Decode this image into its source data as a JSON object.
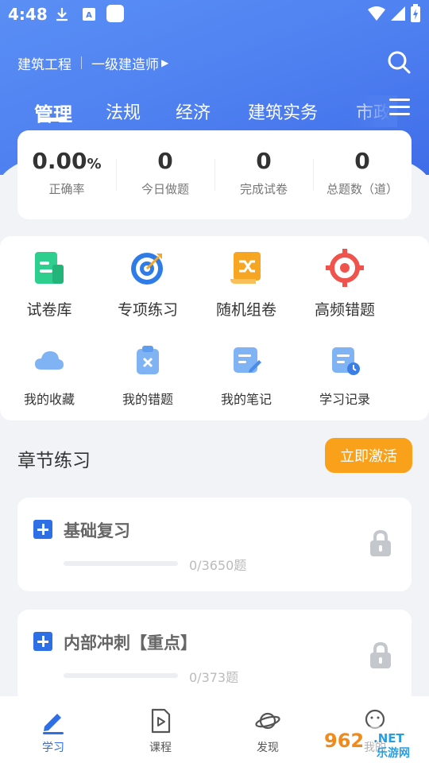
{
  "status_bar": {
    "time": "4:48"
  },
  "header": {
    "category": "建筑工程",
    "level": "一级建造师"
  },
  "tabs": [
    {
      "label": "管理",
      "active": true
    },
    {
      "label": "法规",
      "active": false
    },
    {
      "label": "经济",
      "active": false
    },
    {
      "label": "建筑实务",
      "active": false
    },
    {
      "label": "市政",
      "active": false
    }
  ],
  "stats": [
    {
      "value": "0.00",
      "unit": "%",
      "label": "正确率"
    },
    {
      "value": "0",
      "unit": "",
      "label": "今日做题"
    },
    {
      "value": "0",
      "unit": "",
      "label": "完成试卷"
    },
    {
      "value": "0",
      "unit": "",
      "label": "总题数（道）"
    }
  ],
  "features_primary": [
    {
      "label": "试卷库",
      "icon": "paper-library-icon"
    },
    {
      "label": "专项练习",
      "icon": "target-icon"
    },
    {
      "label": "随机组卷",
      "icon": "shuffle-scroll-icon"
    },
    {
      "label": "高频错题",
      "icon": "crosshair-icon"
    }
  ],
  "features_secondary": [
    {
      "label": "我的收藏",
      "icon": "cloud-icon"
    },
    {
      "label": "我的错题",
      "icon": "clipboard-x-icon"
    },
    {
      "label": "我的笔记",
      "icon": "note-pen-icon"
    },
    {
      "label": "学习记录",
      "icon": "record-clock-icon"
    }
  ],
  "chapter_section": {
    "title": "章节练习",
    "activate_label": "立即激活"
  },
  "chapters": [
    {
      "title": "基础复习",
      "count": "0/3650题",
      "progress": 0,
      "locked": true
    },
    {
      "title": "内部冲刺【重点】",
      "count": "0/373题",
      "progress": 0,
      "locked": true
    }
  ],
  "bottom_nav": [
    {
      "label": "学习",
      "icon": "pen-icon",
      "active": true
    },
    {
      "label": "课程",
      "icon": "play-file-icon",
      "active": false
    },
    {
      "label": "发现",
      "icon": "planet-icon",
      "active": false
    },
    {
      "label": "我的",
      "icon": "user-face-icon",
      "active": false
    }
  ],
  "watermark": {
    "text1": "962",
    "text2": ".NET",
    "text3": "乐游网"
  },
  "colors": {
    "primary": "#2f6fe6",
    "hero": "#4e7ff0",
    "accent": "#f9a11b",
    "green": "#2ecf8e",
    "red": "#f0534b"
  }
}
